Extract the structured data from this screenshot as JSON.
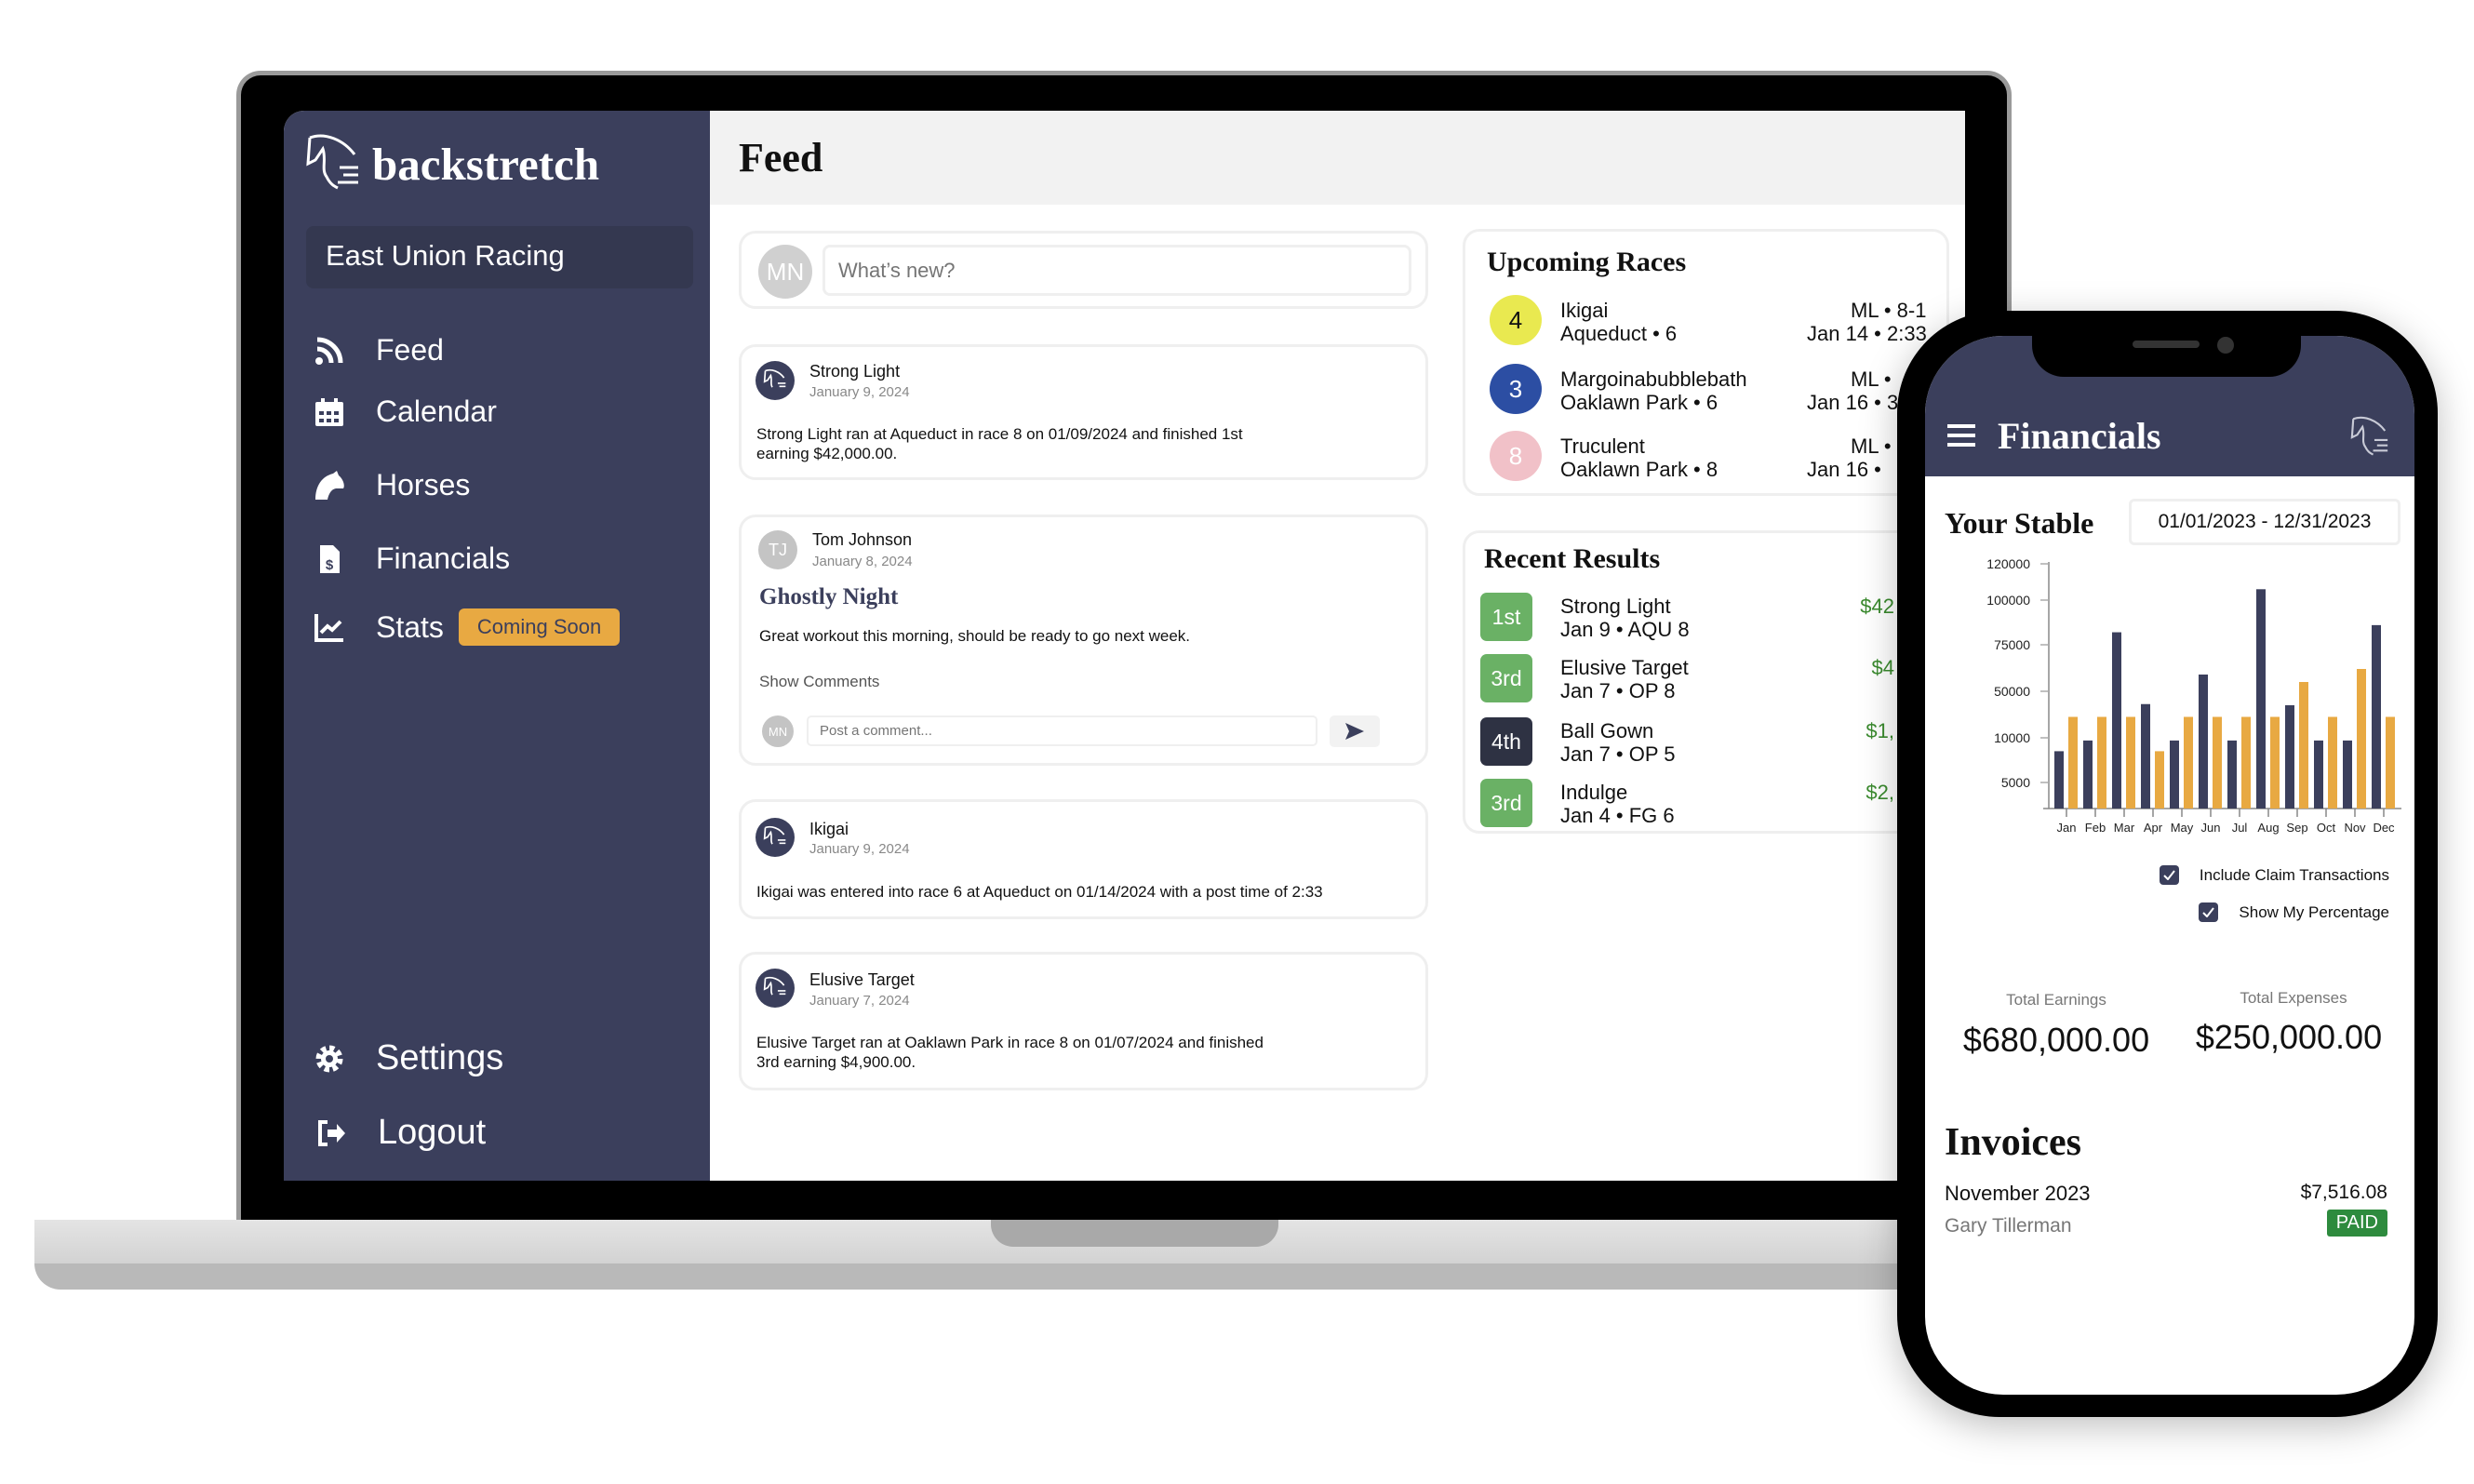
{
  "app": {
    "brand": "backstretch",
    "organization": "East Union Racing"
  },
  "sidebar": {
    "items": [
      {
        "label": "Feed",
        "icon": "rss-icon"
      },
      {
        "label": "Calendar",
        "icon": "calendar-icon"
      },
      {
        "label": "Horses",
        "icon": "horse-head-icon"
      },
      {
        "label": "Financials",
        "icon": "invoice-dollar-icon"
      },
      {
        "label": "Stats",
        "icon": "chart-line-icon",
        "badge": "Coming Soon"
      }
    ],
    "settings": "Settings",
    "logout": "Logout"
  },
  "header": {
    "title": "Feed"
  },
  "composer": {
    "avatar": "MN",
    "placeholder": "What’s new?"
  },
  "posts": [
    {
      "author": "Strong Light",
      "date": "January 9, 2024",
      "lines": [
        "Strong Light ran at Aqueduct in race 8 on 01/09/2024 and finished 1st",
        "earning $42,000.00."
      ]
    },
    {
      "author": "Tom Johnson",
      "avatar": "TJ",
      "date": "January 8, 2024",
      "title": "Ghostly Night",
      "lines": [
        "Great workout this morning, should be ready to go next week."
      ],
      "show_comments": "Show Comments",
      "comment_avatar": "MN",
      "comment_placeholder": "Post a comment..."
    },
    {
      "author": "Ikigai",
      "date": "January 9, 2024",
      "lines": [
        "Ikigai was entered into race 6 at Aqueduct on 01/14/2024 with a post time of 2:33"
      ]
    },
    {
      "author": "Elusive Target",
      "date": "January 7, 2024",
      "lines": [
        "Elusive Target ran at Oaklawn Park in race 8 on 01/07/2024 and finished",
        "3rd earning $4,900.00."
      ]
    }
  ],
  "upcoming": {
    "title": "Upcoming Races",
    "races": [
      {
        "post": "4",
        "color": "#e9e950",
        "text_color": "#111111",
        "horse": "Ikigai",
        "track": "Aqueduct • 6",
        "odds": "ML • 8-1",
        "when": "Jan 14 • 2:33"
      },
      {
        "post": "3",
        "color": "#2c4ea3",
        "text_color": "#ffffff",
        "horse": "Margoinabubblebath",
        "track": "Oaklawn Park • 6",
        "odds": "ML •",
        "when": "Jan 16 • 3"
      },
      {
        "post": "8",
        "color": "#f1c1c8",
        "text_color": "#ffffff",
        "horse": "Truculent",
        "track": "Oaklawn Park • 8",
        "odds": "ML •",
        "when": "Jan 16 •"
      }
    ]
  },
  "recent": {
    "title": "Recent Results",
    "results": [
      {
        "place": "1st",
        "color": "#6ab165",
        "horse": "Strong Light",
        "detail": "Jan 9 • AQU 8",
        "amount": "$42"
      },
      {
        "place": "3rd",
        "color": "#6ab165",
        "horse": "Elusive Target",
        "detail": "Jan 7 • OP 8",
        "amount": "$4"
      },
      {
        "place": "4th",
        "color": "#2e3243",
        "horse": "Ball Gown",
        "detail": "Jan 7 • OP 5",
        "amount": "$1,"
      },
      {
        "place": "3rd",
        "color": "#6ab165",
        "horse": "Indulge",
        "detail": "Jan 4 • FG 6",
        "amount": "$2,"
      }
    ]
  },
  "phone": {
    "title": "Financials",
    "stable_title": "Your Stable",
    "date_range": "01/01/2023 - 12/31/2023",
    "options": [
      {
        "label": "Include Claim Transactions",
        "checked": true
      },
      {
        "label": "Show My Percentage",
        "checked": true
      }
    ],
    "totals": [
      {
        "label": "Total Earnings",
        "value": "$680,000.00"
      },
      {
        "label": "Total Expenses",
        "value": "$250,000.00"
      }
    ],
    "invoices_title": "Invoices",
    "invoice": {
      "period": "November 2023",
      "name": "Gary Tillerman",
      "amount": "$7,516.08",
      "status": "PAID"
    }
  },
  "colors": {
    "sidebar": "#3b3f5c",
    "accent": "#e8a942",
    "earned": "#3a8a2e",
    "paid": "#2e8b3e"
  },
  "chart_data": {
    "type": "bar",
    "categories": [
      "Jan",
      "Feb",
      "Mar",
      "Apr",
      "May",
      "Jun",
      "Jul",
      "Aug",
      "Sep",
      "Oct",
      "Nov",
      "Dec"
    ],
    "yticks": [
      5000,
      10000,
      50000,
      75000,
      100000,
      120000
    ],
    "ylim": [
      0,
      120000
    ],
    "grid": false,
    "series": [
      {
        "color": "#3b3f5c",
        "values": [
          8500,
          9700,
          82000,
          39000,
          9700,
          59000,
          9700,
          106000,
          38000,
          9700,
          9700,
          86000
        ]
      },
      {
        "color": "#e8a942",
        "values": [
          28000,
          28000,
          28000,
          8500,
          28000,
          28000,
          28000,
          28000,
          55000,
          28000,
          62000,
          28000
        ]
      }
    ]
  }
}
